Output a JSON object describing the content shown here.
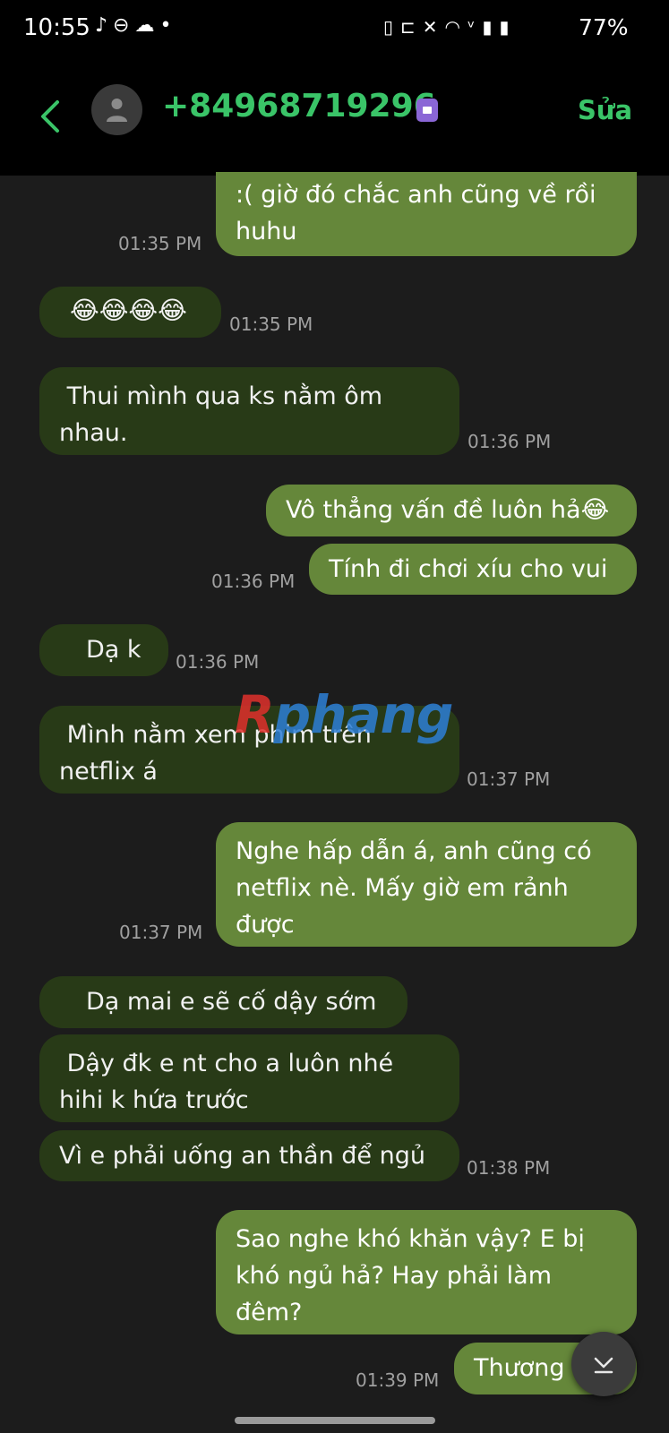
{
  "status_bar": {
    "time": "10:55",
    "battery": "77%",
    "left_icons": [
      "tiktok-icon",
      "do-not-disturb-icon",
      "cloud-icon",
      "dot-icon"
    ],
    "right_icons": [
      "nfc-icon",
      "sleep-icon",
      "mute-icon",
      "wifi-icon",
      "volte-icon",
      "signal-icon",
      "signal-icon",
      "battery-icon"
    ]
  },
  "header": {
    "contact": "+84968719296",
    "edit_label": "Sửa"
  },
  "messages": [
    {
      "dir": "out",
      "text": ":( giờ đó chắc anh cũng về rồi huhu",
      "time": "01:35 PM"
    },
    {
      "dir": "in",
      "text": "😂😂😂😂",
      "time": "01:35 PM"
    },
    {
      "dir": "in",
      "text": " Thui mình qua ks nằm ôm nhau.",
      "time": "01:36 PM"
    },
    {
      "dir": "out",
      "text": "Vô thẳng vấn đề luôn hả😂",
      "time": ""
    },
    {
      "dir": "out",
      "text": "Tính đi chơi xíu cho vui",
      "time": "01:36 PM"
    },
    {
      "dir": "in",
      "text": "Dạ k",
      "time": "01:36 PM"
    },
    {
      "dir": "in",
      "text": " Mình nằm xem phim trên netflix á",
      "time": "01:37 PM"
    },
    {
      "dir": "out",
      "text": "Nghe hấp dẫn á, anh cũng có netflix nè. Mấy giờ em rảnh được",
      "time": "01:37 PM"
    },
    {
      "dir": "in",
      "text": "Dạ mai e sẽ cố dậy sớm",
      "time": ""
    },
    {
      "dir": "in",
      "text": " Dậy đk e nt cho a luôn nhé hihi k hứa trước",
      "time": ""
    },
    {
      "dir": "in",
      "text": "Vì e phải uống an thần để ngủ",
      "time": "01:38 PM"
    },
    {
      "dir": "out",
      "text": "Sao nghe khó khăn vậy? E bị khó ngủ hả? Hay phải làm đêm?",
      "time": ""
    },
    {
      "dir": "out",
      "text": "Thương",
      "time": "01:39 PM"
    }
  ],
  "watermark": {
    "part1": "R",
    "part2": "phang"
  },
  "colors": {
    "accent_green": "#3ac468",
    "outgoing_bubble": "#65873a",
    "incoming_bubble": "#283a17",
    "background": "#1c1c1c"
  },
  "scroll_button_icon": "chevron-down-icon"
}
